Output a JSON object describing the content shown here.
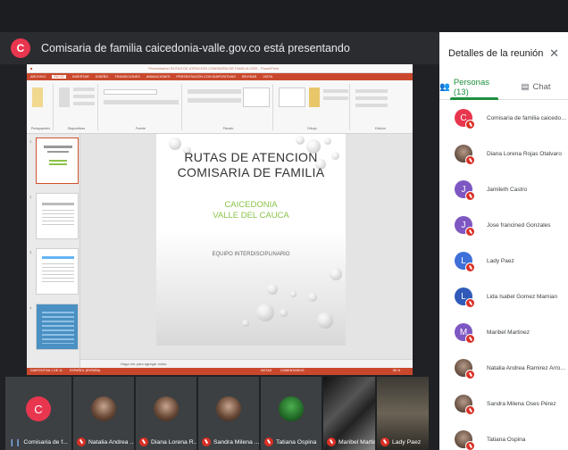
{
  "presenter": {
    "avatar_letter": "C",
    "text": "Comisaria de familia caicedonia-valle.gov.co está presentando"
  },
  "ppt": {
    "window_title": "Presentación RUTAS DE ATENCION COMISARIA DE FAMILIA 2020 - PowerPoint",
    "tabs": [
      "ARCHIVO",
      "INICIO",
      "INSERTAR",
      "DISEÑO",
      "TRANSICIONES",
      "ANIMACIONES",
      "PRESENTACIÓN CON DIAPOSITIVAS",
      "REVISAR",
      "VISTA"
    ],
    "groups": [
      "Portapapeles",
      "Diapositivas",
      "Fuente",
      "Párrafo",
      "Dibujo",
      "Edición"
    ],
    "thumb_numbers": [
      "1",
      "2",
      "3",
      "4"
    ],
    "notes_placeholder": "Haga clic para agregar notas",
    "status_left": "DIAPOSITIVA 1 DE 11",
    "status_lang": "ESPAÑOL (ESPAÑA)",
    "status_notes": "NOTAS",
    "status_comments": "COMENTARIOS",
    "zoom": "55 %"
  },
  "slide": {
    "title_line1": "RUTAS DE ATENCION",
    "title_line2": "COMISARIA DE FAMILIA",
    "sub_line1": "CAICEDONIA",
    "sub_line2": "VALLE DEL CAUCA",
    "team": "EQUIPO INTERDISCIPLINARIO"
  },
  "panel": {
    "title": "Detalles de la reunión",
    "close_icon": "close-icon",
    "tab_people": "Personas (13)",
    "tab_chat": "Chat",
    "participants": [
      {
        "name": "Comisaria de familia caicedoni...",
        "letter": "C",
        "color": "#e8364f"
      },
      {
        "name": "Diana Lorena Rojas Otalvaro",
        "letter": "",
        "color": ""
      },
      {
        "name": "Jamileth Castro",
        "letter": "J",
        "color": "#7e57c2"
      },
      {
        "name": "Jose francined Gonzales",
        "letter": "J",
        "color": "#7e57c2"
      },
      {
        "name": "Lady Paez",
        "letter": "L",
        "color": "#3f6fd8"
      },
      {
        "name": "Lida Isabel Gomez Mamian",
        "letter": "L",
        "color": "#2f5ab9"
      },
      {
        "name": "Maribel Martinez",
        "letter": "M",
        "color": "#7e57c2"
      },
      {
        "name": "Natalia Andrea Ramirez Arroya...",
        "letter": "",
        "color": ""
      },
      {
        "name": "Sandra Milena Oses Pérez",
        "letter": "",
        "color": ""
      },
      {
        "name": "Tatiana Ospina",
        "letter": "",
        "color": ""
      }
    ]
  },
  "film": {
    "tiles": [
      {
        "name": "Comisaria de f...",
        "letter": "C"
      },
      {
        "name": "Natalia Andrea ...",
        "letter": ""
      },
      {
        "name": "Diana Lorena R...",
        "letter": ""
      },
      {
        "name": "Sandra Milena ...",
        "letter": ""
      },
      {
        "name": "Tatiana Ospina",
        "letter": ""
      },
      {
        "name": "Maribel Martinez",
        "letter": ""
      },
      {
        "name": "Lady Paez",
        "letter": ""
      }
    ]
  }
}
